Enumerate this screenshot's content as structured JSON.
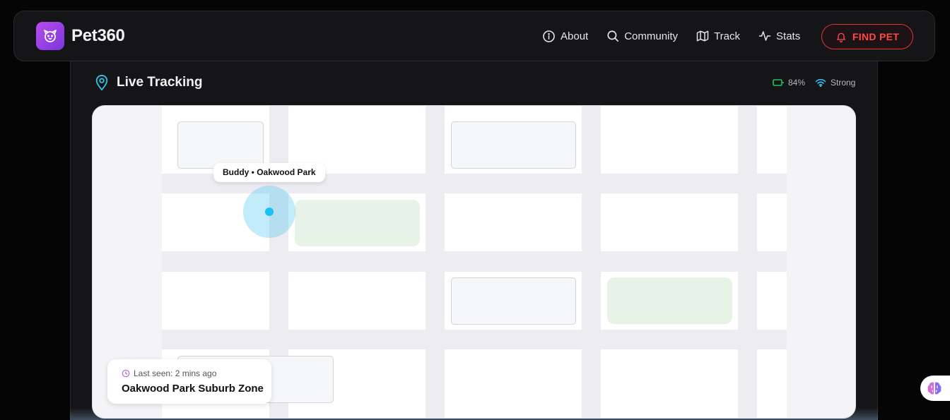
{
  "brand": {
    "name": "Pet360",
    "logo_icon": "dog-face-icon",
    "logo_color": "#a944e8"
  },
  "nav": {
    "items": [
      {
        "label": "About",
        "icon": "info-icon"
      },
      {
        "label": "Community",
        "icon": "search-icon"
      },
      {
        "label": "Track",
        "icon": "map-icon"
      },
      {
        "label": "Stats",
        "icon": "activity-icon"
      }
    ],
    "cta": {
      "label": "FIND PET",
      "icon": "bell-icon",
      "color": "#ff4a46"
    }
  },
  "tracking": {
    "title": "Live Tracking",
    "title_icon": "location-pin-icon",
    "battery": {
      "value": "84%",
      "icon": "battery-icon",
      "color": "#22c55e"
    },
    "signal": {
      "value": "Strong",
      "icon": "wifi-icon",
      "color": "#38bdf8"
    }
  },
  "map": {
    "pet_label": "Buddy • Oakwood Park",
    "marker_color": "#19c0f5",
    "last_seen": {
      "time": "Last seen: 2 mins ago",
      "zone": "Oakwood Park Suburb Zone",
      "icon": "clock-icon"
    }
  },
  "assistant_icon": "brain-icon"
}
